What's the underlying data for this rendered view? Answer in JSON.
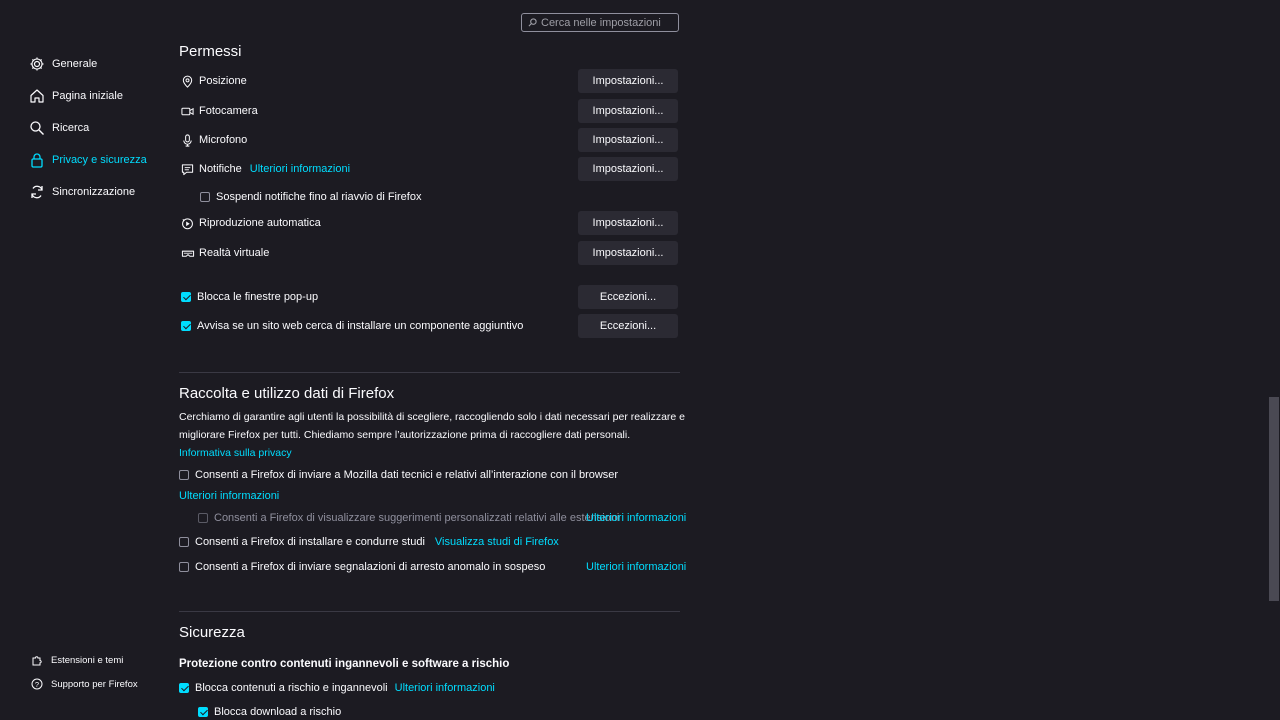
{
  "search": {
    "placeholder": "Cerca nelle impostazioni"
  },
  "sidebar": {
    "items": [
      {
        "label": "Generale",
        "icon": "gear-icon"
      },
      {
        "label": "Pagina iniziale",
        "icon": "home-icon"
      },
      {
        "label": "Ricerca",
        "icon": "search-icon"
      },
      {
        "label": "Privacy e sicurezza",
        "icon": "lock-icon",
        "active": true
      },
      {
        "label": "Sincronizzazione",
        "icon": "sync-icon"
      }
    ],
    "footer": [
      {
        "label": "Estensioni e temi",
        "icon": "puzzle-icon"
      },
      {
        "label": "Supporto per Firefox",
        "icon": "help-icon"
      }
    ]
  },
  "permissions": {
    "heading": "Permessi",
    "rows": [
      {
        "label": "Posizione",
        "button": "Impostazioni...",
        "icon": "location-pin-icon"
      },
      {
        "label": "Fotocamera",
        "button": "Impostazioni...",
        "icon": "camera-icon"
      },
      {
        "label": "Microfono",
        "button": "Impostazioni...",
        "icon": "microphone-icon"
      },
      {
        "label": "Notifiche",
        "link": "Ulteriori informazioni",
        "button": "Impostazioni...",
        "icon": "notification-icon"
      },
      {
        "label": "Riproduzione automatica",
        "button": "Impostazioni...",
        "icon": "autoplay-icon"
      },
      {
        "label": "Realtà virtuale",
        "button": "Impostazioni...",
        "icon": "vr-headset-icon"
      }
    ],
    "pause_notifications": {
      "label": "Sospendi notifiche fino al riavvio di Firefox",
      "checked": false
    },
    "block_popups": {
      "label": "Blocca le finestre pop-up",
      "checked": true,
      "button": "Eccezioni..."
    },
    "warn_addons": {
      "label": "Avvisa se un sito web cerca di installare un componente aggiuntivo",
      "checked": true,
      "button": "Eccezioni..."
    }
  },
  "data_collection": {
    "title": "Raccolta e utilizzo dati di Firefox",
    "description_line1": "Cerchiamo di garantire agli utenti la possibilità di scegliere, raccogliendo solo i dati necessari per realizzare e",
    "description_line2": "migliorare Firefox per tutti. Chiediamo sempre l’autorizzazione prima di raccogliere dati personali.",
    "privacy_link": "Informativa sulla privacy",
    "technical": {
      "label": "Consenti a Firefox di inviare a Mozilla dati tecnici e relativi all’interazione con il browser",
      "checked": false
    },
    "technical_link": "Ulteriori informazioni",
    "suggestions": {
      "label": "Consenti a Firefox di visualizzare suggerimenti personalizzati relativi alle estensioni",
      "checked": false,
      "link": "Ulteriori informazioni"
    },
    "studies": {
      "label": "Consenti a Firefox di installare e condurre studi",
      "checked": false,
      "link": "Visualizza studi di Firefox"
    },
    "crash": {
      "label": "Consenti a Firefox di inviare segnalazioni di arresto anomalo in sospeso",
      "checked": false,
      "link": "Ulteriori informazioni"
    }
  },
  "security": {
    "title": "Sicurezza",
    "subtitle": "Protezione contro contenuti ingannevoli e software a rischio",
    "block_dangerous": {
      "label": "Blocca contenuti a rischio e ingannevoli",
      "checked": true,
      "link": "Ulteriori informazioni"
    },
    "block_downloads": {
      "label": "Blocca download a rischio",
      "checked": true
    }
  },
  "colors": {
    "background": "#1c1b22",
    "accent": "#00ddff",
    "button": "#2b2a33",
    "text": "#fbfbfe"
  }
}
